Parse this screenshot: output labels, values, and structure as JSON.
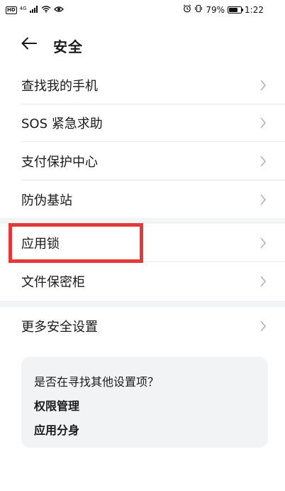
{
  "status_bar": {
    "hd": "HD",
    "network": "4G",
    "battery_percent": "79%",
    "battery_level": 0.79,
    "time": "1:22"
  },
  "header": {
    "title": "安全"
  },
  "menu": {
    "items": [
      {
        "label": "查找我的手机"
      },
      {
        "label": "SOS 紧急求助"
      },
      {
        "label": "支付保护中心"
      },
      {
        "label": "防伪基站"
      },
      {
        "label": "应用锁"
      },
      {
        "label": "文件保密柜"
      },
      {
        "label": "更多安全设置"
      }
    ]
  },
  "suggestions": {
    "title": "是否在寻找其他设置项？",
    "links": [
      {
        "label": "权限管理"
      },
      {
        "label": "应用分身"
      }
    ]
  },
  "colors": {
    "highlight": "#e23a3a",
    "section_bg": "#f1f3f5"
  }
}
